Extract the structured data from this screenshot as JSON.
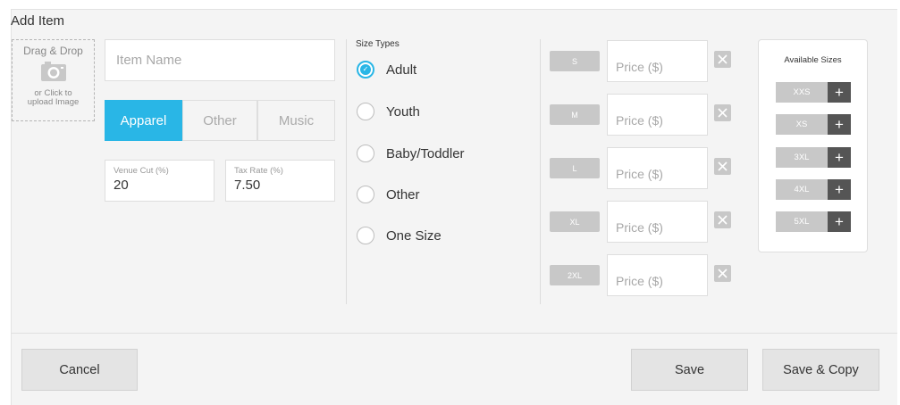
{
  "dialog": {
    "title": "Add Item"
  },
  "upload": {
    "title": "Drag & Drop",
    "subtitle_line1": "or Click to",
    "subtitle_line2": "upload Image"
  },
  "item_name": {
    "placeholder": "Item Name",
    "value": ""
  },
  "categories": [
    {
      "label": "Apparel",
      "active": true
    },
    {
      "label": "Other",
      "active": false
    },
    {
      "label": "Music",
      "active": false
    }
  ],
  "venue_cut": {
    "label": "Venue Cut (%)",
    "value": "20"
  },
  "tax_rate": {
    "label": "Tax Rate (%)",
    "value": "7.50"
  },
  "size_types": {
    "label": "Size Types",
    "options": [
      {
        "label": "Adult",
        "checked": true
      },
      {
        "label": "Youth",
        "checked": false
      },
      {
        "label": "Baby/Toddler",
        "checked": false
      },
      {
        "label": "Other",
        "checked": false
      },
      {
        "label": "One Size",
        "checked": false
      }
    ]
  },
  "sizes": [
    {
      "name": "S",
      "price_placeholder": "Price ($)"
    },
    {
      "name": "M",
      "price_placeholder": "Price ($)"
    },
    {
      "name": "L",
      "price_placeholder": "Price ($)"
    },
    {
      "name": "XL",
      "price_placeholder": "Price ($)"
    },
    {
      "name": "2XL",
      "price_placeholder": "Price ($)"
    }
  ],
  "available_sizes": {
    "title": "Available Sizes",
    "items": [
      {
        "name": "XXS",
        "action": "+"
      },
      {
        "name": "XS",
        "action": "+"
      },
      {
        "name": "3XL",
        "action": "+"
      },
      {
        "name": "4XL",
        "action": "+"
      },
      {
        "name": "5XL",
        "action": "+"
      }
    ]
  },
  "footer": {
    "cancel_label": "Cancel",
    "save_label": "Save",
    "save_copy_label": "Save & Copy"
  },
  "colors": {
    "accent": "#29b6e6",
    "tag_gray": "#c8c8c8",
    "plus_dark": "#555555",
    "panel_bg": "#f4f4f4"
  },
  "icons": {
    "upload": "camera-icon",
    "remove": "close-icon",
    "add": "plus-icon",
    "radio_checked": "check-icon"
  }
}
